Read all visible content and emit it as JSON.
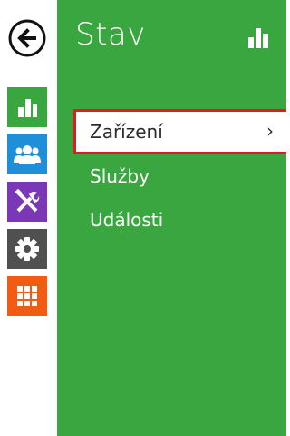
{
  "sidebar": {
    "back_icon": "arrow-left-circle-icon",
    "items": [
      {
        "name": "status",
        "icon": "bar-chart-icon",
        "color": "#3aa63f"
      },
      {
        "name": "directory",
        "icon": "users-icon",
        "color": "#1f8fd9"
      },
      {
        "name": "hardware",
        "icon": "tools-icon",
        "color": "#7a38b6"
      },
      {
        "name": "system",
        "icon": "gear-icon",
        "color": "#505050"
      },
      {
        "name": "services",
        "icon": "grid-icon",
        "color": "#f25c12"
      }
    ]
  },
  "panel": {
    "title": "Stav",
    "title_icon": "bar-chart-icon",
    "accent": "#3aa63f",
    "menu": [
      {
        "label": "Zařízení",
        "selected": true,
        "arrow": "›"
      },
      {
        "label": "Služby",
        "selected": false
      },
      {
        "label": "Události",
        "selected": false
      }
    ]
  }
}
